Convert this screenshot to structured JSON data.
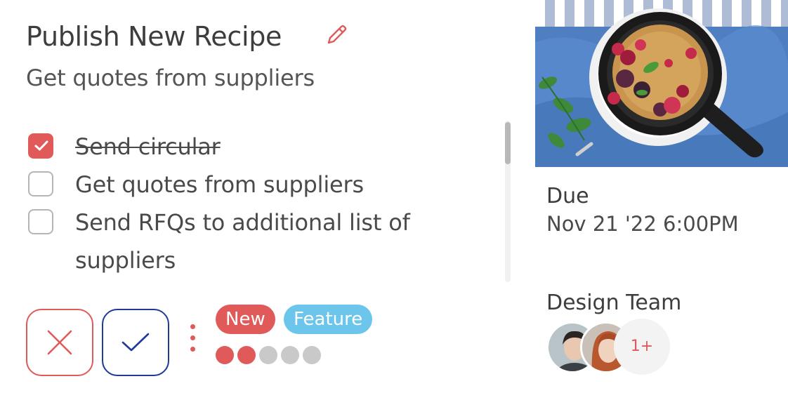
{
  "task": {
    "title": "Publish New Recipe",
    "subtitle": "Get quotes from suppliers",
    "checklist": [
      {
        "label": "Send circular",
        "done": true
      },
      {
        "label": "Get quotes from suppliers",
        "done": false
      },
      {
        "label": "Send RFQs to additional list of suppliers",
        "done": false
      }
    ],
    "tags": [
      {
        "label": "New",
        "color": "#e05a5a"
      },
      {
        "label": "Feature",
        "color": "#6cc5ea"
      }
    ],
    "progress": {
      "filled": 2,
      "total": 5
    }
  },
  "icons": {
    "edit": "pencil-icon",
    "reject": "close-icon",
    "accept": "check-icon",
    "more": "more-vertical-icon"
  },
  "due": {
    "label": "Due",
    "value": "Nov 21 '22 6:00PM"
  },
  "team": {
    "label": "Design Team",
    "more": "1+"
  },
  "colors": {
    "accent": "#e05a5a",
    "accept": "#1f3a9a",
    "feature": "#6cc5ea"
  }
}
